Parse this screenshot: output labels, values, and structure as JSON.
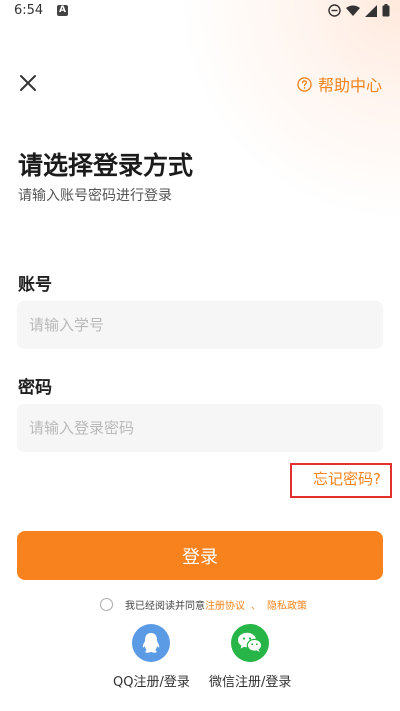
{
  "status_bar": {
    "time": "6:54",
    "notification_letter": "A"
  },
  "header": {
    "help_label": "帮助中心"
  },
  "title": "请选择登录方式",
  "subtitle": "请输入账号密码进行登录",
  "account": {
    "label": "账号",
    "placeholder": "请输入学号",
    "value": ""
  },
  "password": {
    "label": "密码",
    "placeholder": "请输入登录密码",
    "value": ""
  },
  "forgot_password": "忘记密码?",
  "login_button": "登录",
  "agreement": {
    "prefix": "我已经阅读并同意",
    "terms": "注册协议",
    "separator": "、",
    "privacy": "隐私政策"
  },
  "social": {
    "qq_label": "QQ注册/登录",
    "wechat_label": "微信注册/登录"
  },
  "colors": {
    "accent": "#f7821e",
    "qq": "#5b9be6",
    "wechat": "#27b547",
    "highlight_box": "#e23030"
  }
}
